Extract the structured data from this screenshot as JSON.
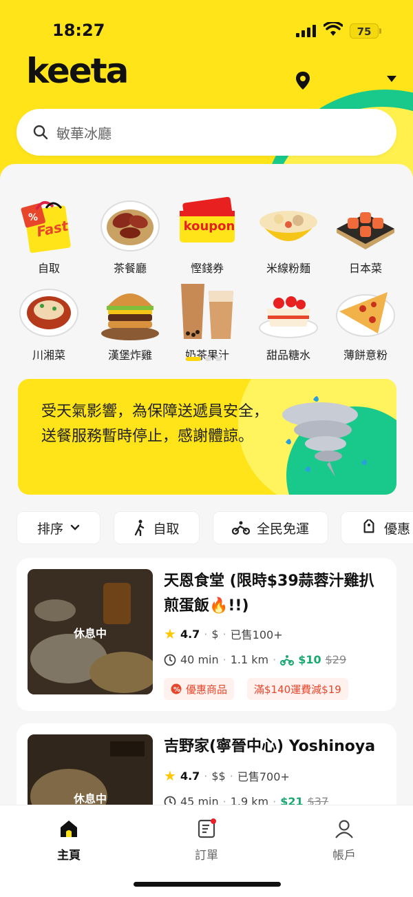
{
  "status": {
    "time": "18:27",
    "battery": "75"
  },
  "app": {
    "logo": "keeta"
  },
  "search": {
    "placeholder": "敏華冰廳"
  },
  "categories": [
    {
      "label": "自取",
      "icon": "fast-bag-icon"
    },
    {
      "label": "茶餐廳",
      "icon": "cha-chaan-teng-icon"
    },
    {
      "label": "慳錢券",
      "icon": "koupon-icon",
      "badge": "koupon"
    },
    {
      "label": "米線粉麵",
      "icon": "noodle-icon"
    },
    {
      "label": "日本菜",
      "icon": "sushi-icon"
    },
    {
      "label": "川湘菜",
      "icon": "sichuan-dish-icon"
    },
    {
      "label": "漢堡炸雞",
      "icon": "burger-icon"
    },
    {
      "label": "奶茶果汁",
      "icon": "milk-tea-icon"
    },
    {
      "label": "甜品糖水",
      "icon": "cake-icon"
    },
    {
      "label": "薄餅意粉",
      "icon": "pizza-icon"
    }
  ],
  "fast_label": "Fast",
  "banner": {
    "text": "受天氣影響，為保障送遞員安全，送餐服務暫時停止，感謝體諒。"
  },
  "filters": [
    {
      "label": "排序",
      "icon": "chevron-down-icon"
    },
    {
      "label": "自取",
      "icon": "walk-icon"
    },
    {
      "label": "全民免運",
      "icon": "bike-icon"
    },
    {
      "label": "優惠",
      "icon": "tag-icon"
    }
  ],
  "restaurants": [
    {
      "name": "天恩食堂 (限時$39蒜蓉汁雞扒煎蛋飯🔥!!)",
      "status": "休息中",
      "rating": "4.7",
      "price": "$",
      "sold": "已售100+",
      "time": "40 min",
      "distance": "1.1 km",
      "fee": "$10",
      "fee_old": "$29",
      "tags": [
        "優惠商品",
        "滿$140運費減$19"
      ]
    },
    {
      "name": "吉野家(寧晉中心) Yoshinoya",
      "status": "休息中",
      "rating": "4.7",
      "price": "$$",
      "sold": "已售700+",
      "time": "45 min",
      "distance": "1.9 km",
      "fee": "$21",
      "fee_old": "$37"
    }
  ],
  "nav": [
    {
      "label": "主頁",
      "icon": "home-icon"
    },
    {
      "label": "訂單",
      "icon": "orders-icon"
    },
    {
      "label": "帳戶",
      "icon": "account-icon"
    }
  ],
  "colors": {
    "brand_yellow": "#ffe41a",
    "brand_green": "#18c98b",
    "promo_red": "#e8462b"
  }
}
